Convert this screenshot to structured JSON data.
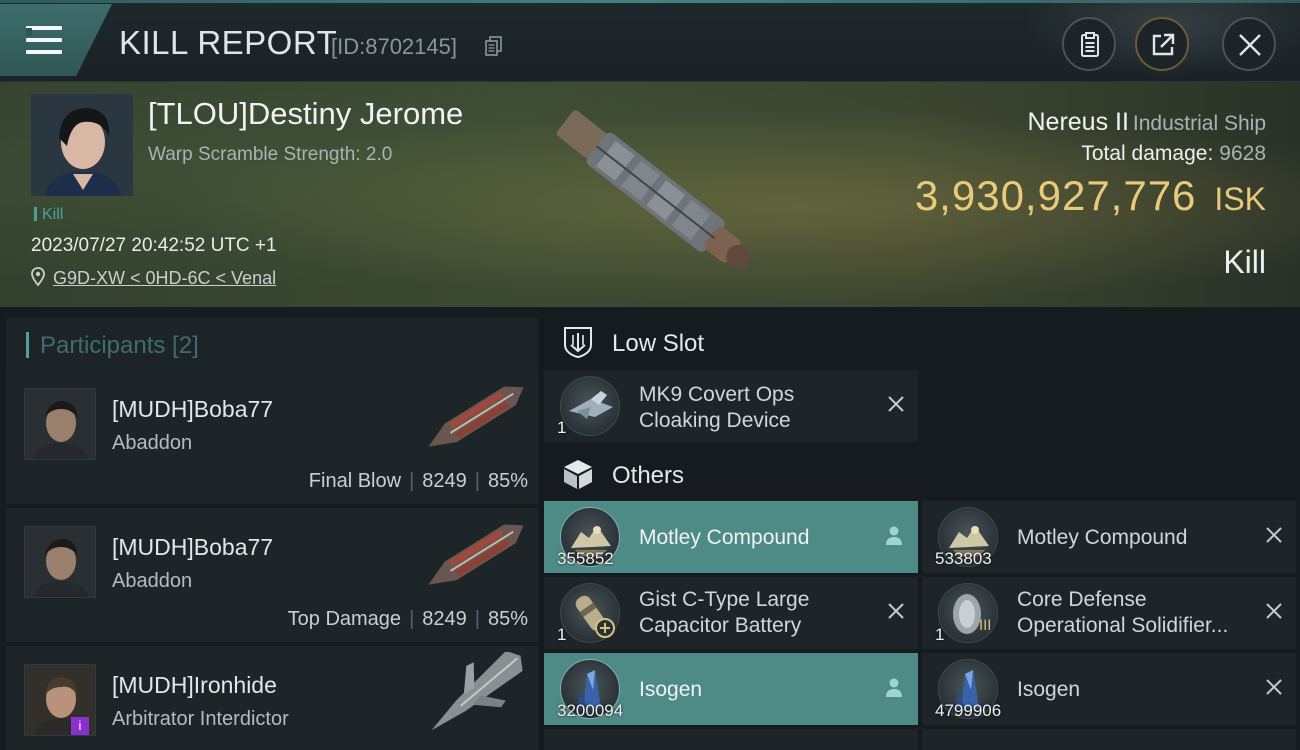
{
  "header": {
    "title": "KILL REPORT",
    "id_label": "[ID:8702145]"
  },
  "victim": {
    "name": "[TLOU]Destiny Jerome",
    "warp_scramble": "Warp Scramble Strength: 2.0",
    "kill_tag": "Kill",
    "datetime": "2023/07/27 20:42:52 UTC +1",
    "location": "G9D-XW < 0HD-6C < Venal",
    "ship_name": "Nereus II",
    "ship_class": "Industrial Ship",
    "total_damage_label": "Total damage:",
    "total_damage_value": "9628",
    "isk_value": "3,930,927,776",
    "isk_unit": "ISK",
    "kill_type": "Kill"
  },
  "participants": {
    "title": "Participants [2]",
    "rows": [
      {
        "name": "[MUDH]Boba77",
        "ship": "Abaddon",
        "role": "Final Blow",
        "damage": "8249",
        "percent": "85%"
      },
      {
        "name": "[MUDH]Boba77",
        "ship": "Abaddon",
        "role": "Top Damage",
        "damage": "8249",
        "percent": "85%"
      },
      {
        "name": "[MUDH]Ironhide",
        "ship": "Arbitrator Interdictor",
        "badge": "i"
      }
    ]
  },
  "sections": {
    "low_slot": "Low Slot",
    "others": "Others"
  },
  "items": {
    "low_slot": [
      {
        "qty": "1",
        "line1": "MK9 Covert Ops",
        "line2": "Cloaking Device"
      }
    ],
    "others": [
      {
        "qty": "355852",
        "line1": "Motley Compound",
        "selected": true
      },
      {
        "qty": "533803",
        "line1": "Motley Compound"
      },
      {
        "qty": "1",
        "line1": "Gist C-Type Large",
        "line2": "Capacitor Battery"
      },
      {
        "qty": "1",
        "line1": "Core Defense",
        "line2": "Operational Solidifier..."
      },
      {
        "qty": "3200094",
        "line1": "Isogen",
        "selected": true
      },
      {
        "qty": "4799906",
        "line1": "Isogen"
      }
    ]
  },
  "colors": {
    "accent": "#4f9f9b",
    "isk": "#e9c97a",
    "selected_item": "#4e8a86"
  }
}
